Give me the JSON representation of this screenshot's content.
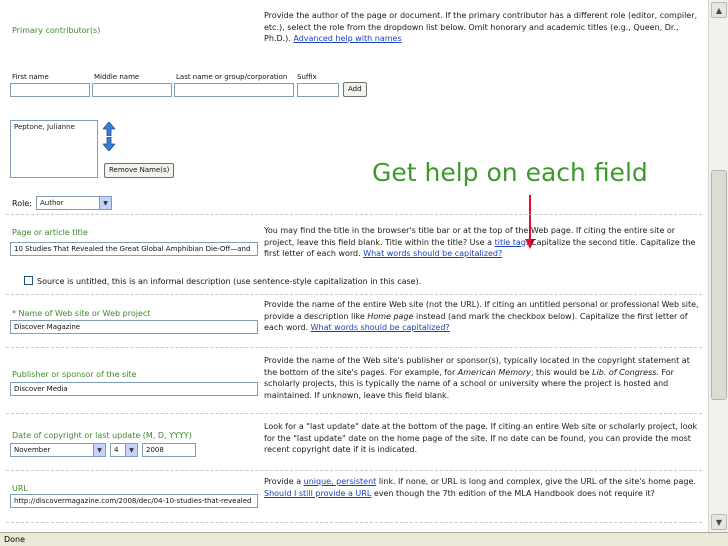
{
  "primary": {
    "title": "Primary contributor(s)",
    "desc": "Provide the author of the page or document. If the primary contributor has a different role (editor, compiler, etc.), select the role from the dropdown list below. Omit honorary and academic titles (e.g., Queen, Dr., Ph.D.). ",
    "desc_link": "Advanced help with names",
    "first_label": "First name",
    "middle_label": "Middle name",
    "last_label": "Last name or group/corporation",
    "suffix_label": "Suffix",
    "add_btn": "Add",
    "list_item": "Peptone, Julianne",
    "remove_btn": "Remove Name(s)",
    "role_label": "Role:",
    "role_value": "Author"
  },
  "callout": "Get help on each field",
  "title_section": {
    "title": "Page or article title",
    "value": "10 Studies That Revealed the Great Global Amphibian Die-Off—and",
    "desc_1": "You may find the title in the browser's title bar or at the top of the Web page. If citing the entire site or project, leave this field blank. Title within the title? Use a ",
    "desc_link_1": "title tag",
    "desc_2": ". Capitalize the second title. Capitalize the first letter of each word. ",
    "desc_link_2": "What words should be capitalized?",
    "checkbox_label": "Source is untitled, this is an informal description (use sentence-style capitalization in this case)."
  },
  "website": {
    "title": "Name of Web site or Web project",
    "req": "* ",
    "value": "Discover Magazine",
    "desc_1": "Provide the name of the entire Web site (not the URL). If citing an untitled personal or professional Web site, provide a description like ",
    "desc_em": "Home page",
    "desc_2": " instead (and mark the checkbox below). Capitalize the first letter of each word. ",
    "desc_link": "What words should be capitalized?"
  },
  "publisher": {
    "title": "Publisher or sponsor of the site",
    "value": "Discover Media",
    "desc_1": "Provide the name of the Web site's publisher or sponsor(s), typically located in the copyright statement at the bottom of the site's pages. For example, for ",
    "desc_em_1": "American Memory",
    "desc_2": ", this would be ",
    "desc_em_2": "Lib. of Congress",
    "desc_3": ". For scholarly projects, this is typically the name of a school or university where the project is hosted and maintained. If unknown, leave this field blank."
  },
  "date": {
    "title": "Date of copyright or last update (M, D, YYYY)",
    "month": "November",
    "day": "4",
    "year": "2008",
    "desc": "Look for a \"last update\" date at the bottom of the page. If citing an entire Web site or scholarly project, look for the \"last update\" date on the home page of the site. If no date can be found, you can provide the most recent copyright date if it is indicated."
  },
  "url": {
    "title": "URL",
    "value": "http://discovermagazine.com/2008/dec/04-10-studies-that-revealed",
    "desc_1": "Provide a ",
    "desc_link_1": "unique, persistent",
    "desc_2": " link. If none, or URL is long and complex, give the URL of the site's home page. ",
    "desc_link_2": "Should I still provide a URL",
    "desc_3": " even though the 7th edition of the MLA Handbook does not require it?"
  },
  "status": "Done",
  "colors": {
    "label_green": "#3d8a2b",
    "link_blue": "#1a3fbf",
    "callout_green": "#3b9a2a",
    "arrow_red": "#e0102a"
  },
  "icons": {
    "move_up": "up-arrow-icon",
    "move_down": "down-arrow-icon"
  }
}
